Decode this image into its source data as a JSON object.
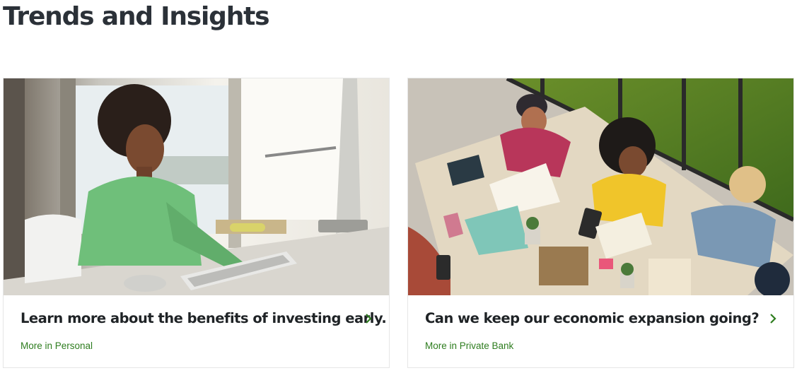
{
  "section": {
    "title": "Trends and Insights"
  },
  "cards": [
    {
      "title": "Learn more about the benefits of investing early.",
      "link_label": "More in Personal",
      "image": "woman-typing-at-desk-photo",
      "arrow_icon": "chevron-right-icon"
    },
    {
      "title": "Can we keep our economic expansion going?",
      "link_label": "More in Private Bank",
      "image": "team-meeting-overhead-photo",
      "arrow_icon": "chevron-right-icon"
    }
  ],
  "colors": {
    "heading": "#2b3138",
    "link": "#2e7d1f",
    "accent": "#2e7d1f",
    "border": "#e6e6e6"
  }
}
